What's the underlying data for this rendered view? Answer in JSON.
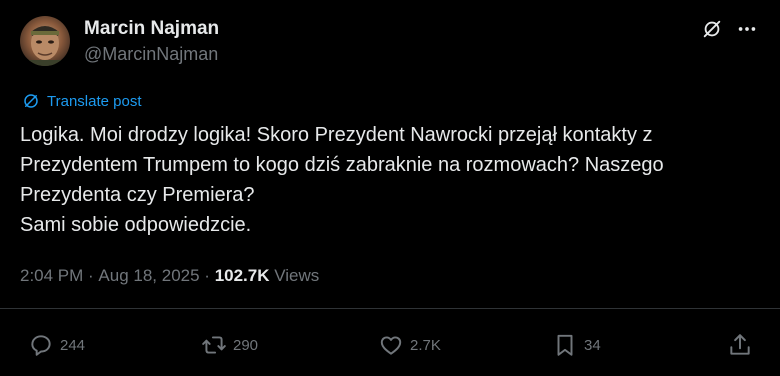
{
  "author": {
    "name": "Marcin Najman",
    "handle": "@MarcinNajman"
  },
  "translate_label": "Translate post",
  "tweet": {
    "text": "Logika. Moi drodzy logika! Skoro Prezydent Nawrocki przejął kontakty z Prezydentem Trumpem to kogo dziś zabraknie na rozmowach? Naszego Prezydenta czy Premiera?\n  Sami sobie odpowiedzcie."
  },
  "meta": {
    "time": "2:04 PM",
    "sep1": " · ",
    "date": "Aug 18, 2025",
    "sep2": " · ",
    "views_count": "102.7K",
    "views_label": " Views"
  },
  "actions": {
    "replies": "244",
    "reposts": "290",
    "likes": "2.7K",
    "bookmarks": "34"
  },
  "colors": {
    "background": "#000000",
    "text": "#e7e9ea",
    "secondary": "#71767b",
    "link": "#1d9bf0"
  }
}
